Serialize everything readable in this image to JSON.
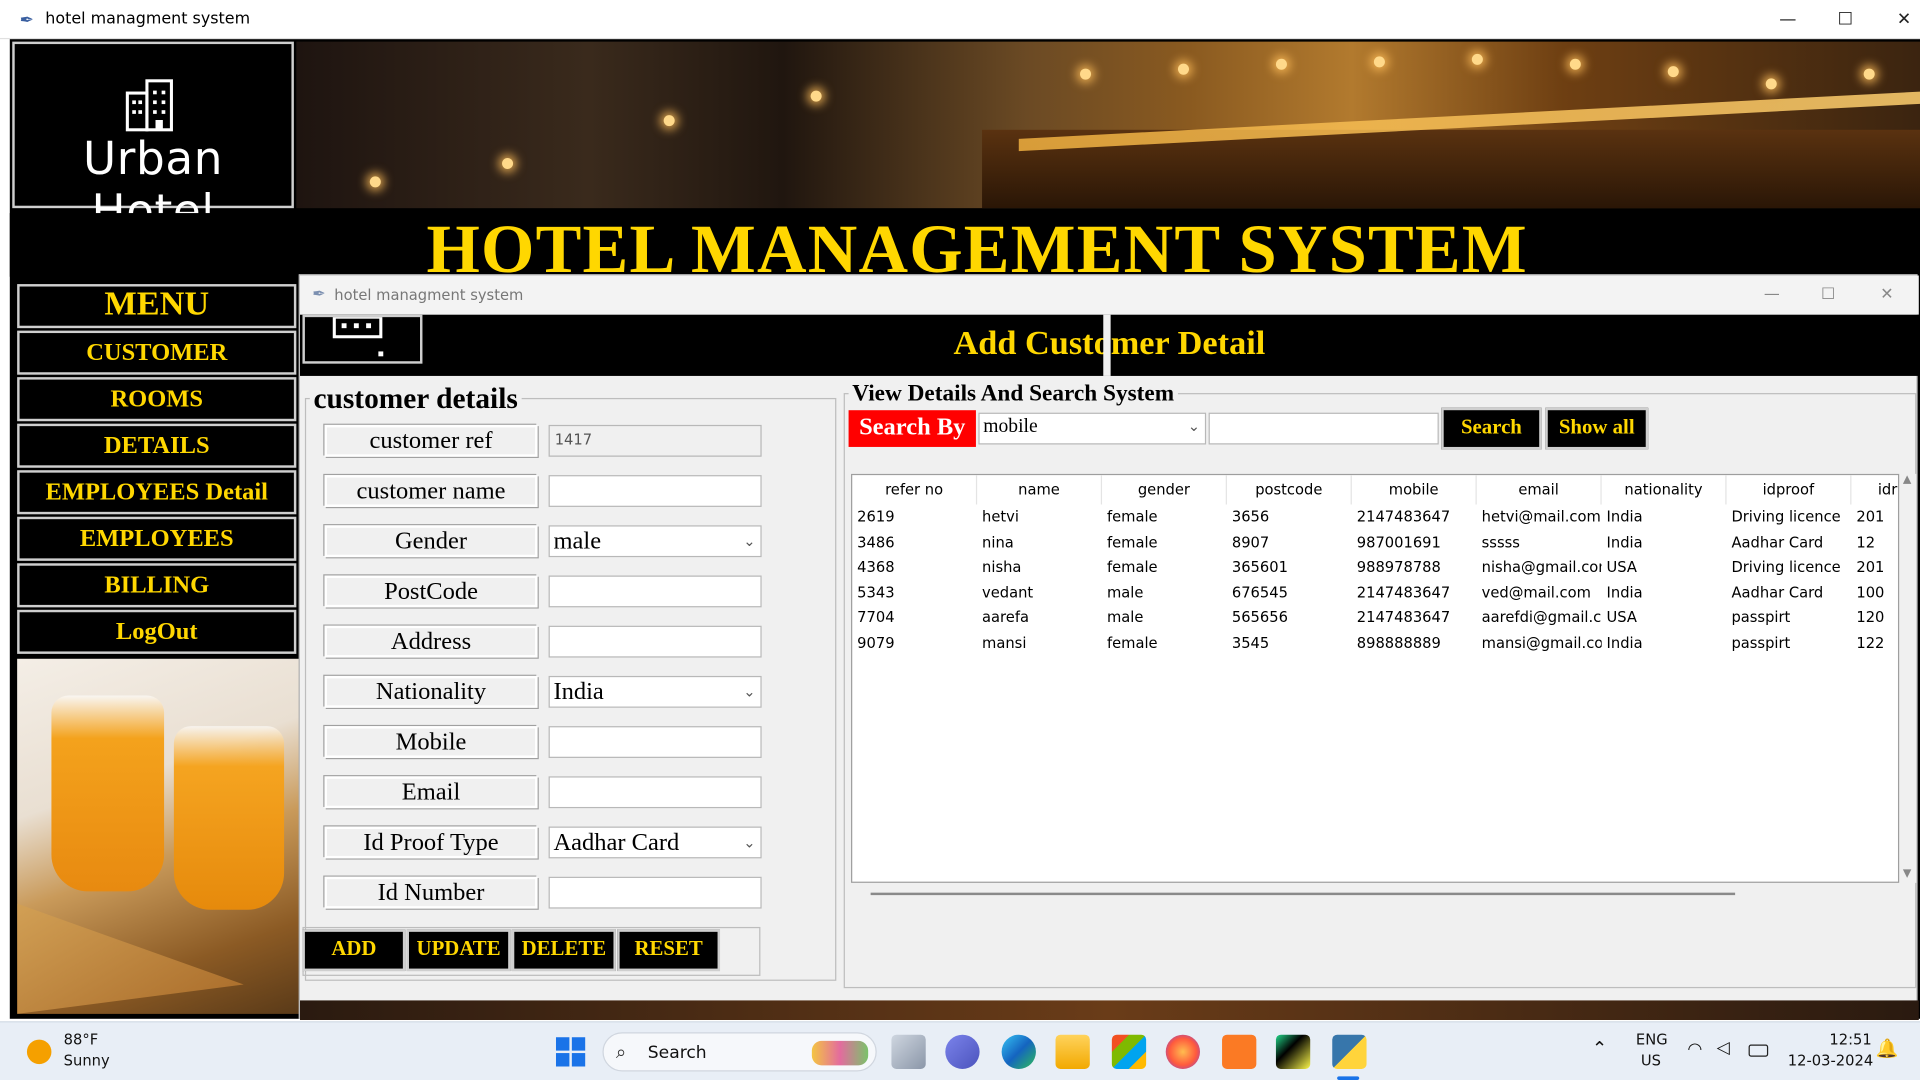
{
  "window": {
    "title": "hotel managment system",
    "controls": {
      "minimize": "—",
      "maximize": "☐",
      "close": "✕"
    }
  },
  "brand": {
    "logo_text": "Urban Hotel",
    "system_title": "HOTEL MANAGEMENT SYSTEM"
  },
  "menu": {
    "heading": "MENU",
    "items": [
      {
        "label": "CUSTOMER"
      },
      {
        "label": "ROOMS"
      },
      {
        "label": "DETAILS"
      },
      {
        "label": "EMPLOYEES Detail"
      },
      {
        "label": "EMPLOYEES"
      },
      {
        "label": "BILLING"
      },
      {
        "label": "LogOut"
      }
    ]
  },
  "child_window": {
    "title": "hotel managment system",
    "heading": "Add Customer Detail",
    "controls": {
      "minimize": "—",
      "maximize": "☐",
      "close": "✕"
    }
  },
  "customer_form": {
    "frame_title": "customer details",
    "fields": [
      {
        "label": "customer ref",
        "type": "text",
        "value": "1417",
        "readonly": true
      },
      {
        "label": "customer name",
        "type": "text",
        "value": ""
      },
      {
        "label": "Gender",
        "type": "select",
        "value": "male"
      },
      {
        "label": "PostCode",
        "type": "text",
        "value": ""
      },
      {
        "label": "Address",
        "type": "text",
        "value": ""
      },
      {
        "label": "Nationality",
        "type": "select",
        "value": "India"
      },
      {
        "label": "Mobile",
        "type": "text",
        "value": ""
      },
      {
        "label": "Email",
        "type": "text",
        "value": ""
      },
      {
        "label": "Id Proof Type",
        "type": "select",
        "value": "Aadhar Card"
      },
      {
        "label": "Id Number",
        "type": "text",
        "value": ""
      }
    ],
    "buttons": {
      "add": "ADD",
      "update": "UPDATE",
      "delete": "DELETE",
      "reset": "RESET"
    }
  },
  "search_panel": {
    "frame_title": "View Details And Search System",
    "search_by_label": "Search By",
    "search_field_value": "mobile",
    "search_text": "",
    "search_button": "Search",
    "show_all_button": "Show all"
  },
  "table": {
    "columns": [
      "refer no",
      "name",
      "gender",
      "postcode",
      "mobile",
      "email",
      "nationality",
      "idproof",
      "idr"
    ],
    "rows": [
      [
        "2619",
        "hetvi",
        "female",
        "3656",
        "2147483647",
        "hetvi@mail.com",
        "India",
        "Driving licence",
        "201"
      ],
      [
        "3486",
        "nina",
        "female",
        "8907",
        "987001691",
        "sssss",
        "India",
        "Aadhar Card",
        "12"
      ],
      [
        "4368",
        "nisha",
        "female",
        "365601",
        "988978788",
        "nisha@gmail.con",
        "USA",
        "Driving licence",
        "201"
      ],
      [
        "5343",
        "vedant",
        "male",
        "676545",
        "2147483647",
        "ved@mail.com",
        "India",
        "Aadhar Card",
        "100"
      ],
      [
        "7704",
        "aarefa",
        "male",
        "565656",
        "2147483647",
        "aarefdi@gmail.co",
        "USA",
        "passpirt",
        "120"
      ],
      [
        "9079",
        "mansi",
        "female",
        "3545",
        "898888889",
        "mansi@gmail.coi",
        "India",
        "passpirt",
        "122"
      ]
    ]
  },
  "taskbar": {
    "weather_temp": "88°F",
    "weather_desc": "Sunny",
    "search_label": "Search",
    "lang_line1": "ENG",
    "lang_line2": "US",
    "time": "12:51",
    "date": "12-03-2024"
  }
}
